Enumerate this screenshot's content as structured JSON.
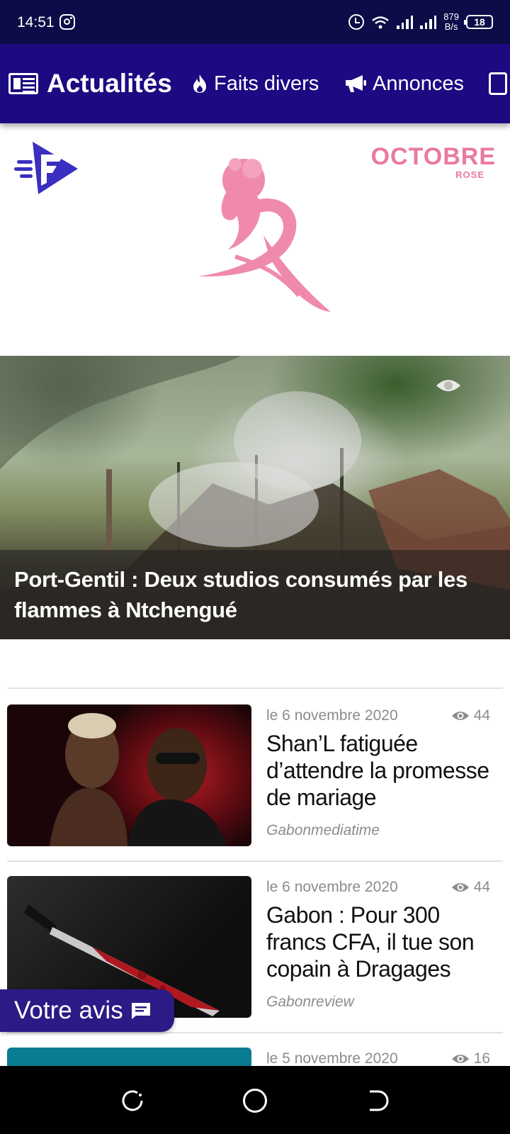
{
  "status_bar": {
    "time": "14:51",
    "net_speed_value": "879",
    "net_speed_unit": "B/s",
    "battery": "18"
  },
  "nav": {
    "tabs": [
      {
        "label": "Actualités",
        "icon": "newspaper-icon",
        "active": true
      },
      {
        "label": "Faits divers",
        "icon": "fire-icon",
        "active": false
      },
      {
        "label": "Annonces",
        "icon": "megaphone-icon",
        "active": false
      }
    ]
  },
  "banner": {
    "campaign_word": "OCTOBRE",
    "campaign_sub": "ROSE",
    "accent_color": "#ea7a9c"
  },
  "featured": {
    "title": "Port-Gentil : Deux studios consumés par les flammes à Ntchengué"
  },
  "articles": [
    {
      "date": "le 6 novembre 2020",
      "views": "44",
      "title": "Shan’L fatiguée d’attendre la promesse de mariage",
      "source": "Gabonmediatime"
    },
    {
      "date": "le 6 novembre 2020",
      "views": "44",
      "title": "Gabon : Pour 300 francs CFA, il tue son copain à Dragages",
      "source": "Gabonreview"
    },
    {
      "date": "le 5 novembre 2020",
      "views": "16",
      "title": "",
      "source": ""
    }
  ],
  "feedback": {
    "label": "Votre avis"
  },
  "colors": {
    "header": "#1b0a82",
    "status_bar": "#0c0c48",
    "feedback": "#2b1b86"
  }
}
